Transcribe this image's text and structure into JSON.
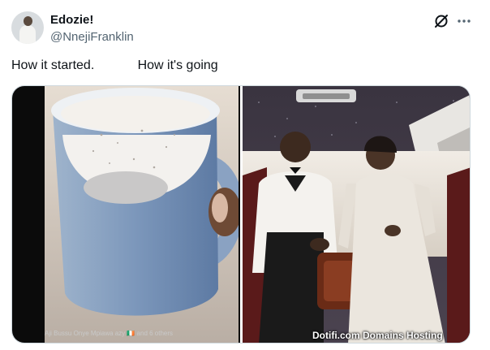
{
  "author": {
    "display_name": "Edozie!",
    "handle": "@NnejiFranklin"
  },
  "tweet": {
    "text": "How it started.            How it's going"
  },
  "icons": {
    "grok": "grok-icon",
    "more": "more-dots-icon"
  },
  "media": {
    "left_caption": "Aji Bussu Onye Mpiawa azy 🇮🇪 and 6 others",
    "watermark": "Dotifi.com Domains Hosting"
  }
}
